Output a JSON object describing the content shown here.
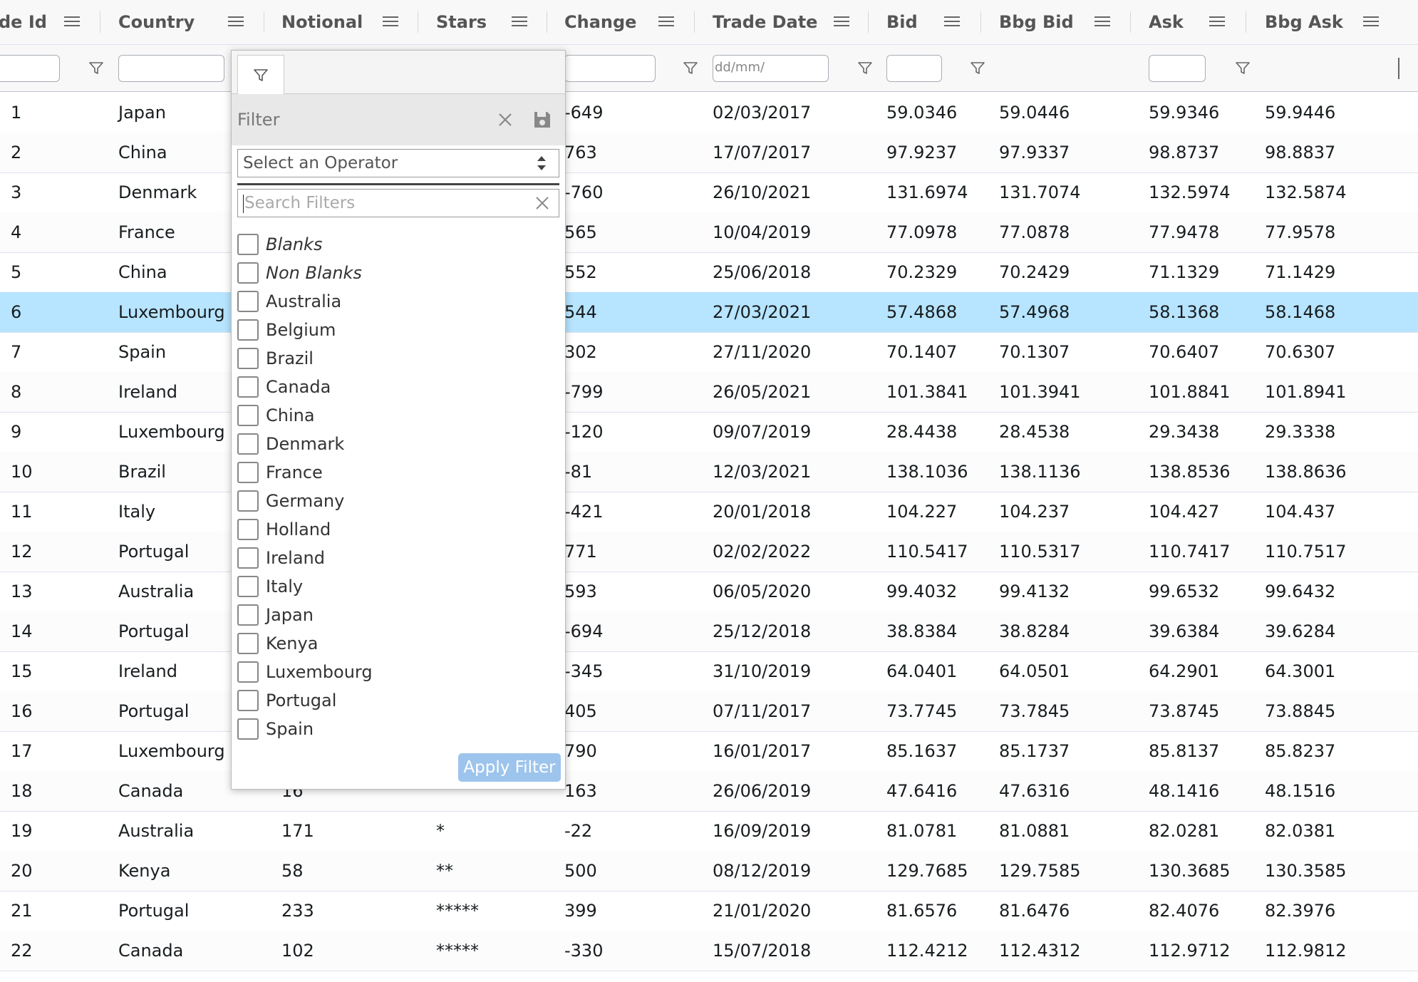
{
  "columns": [
    {
      "label": "de Id"
    },
    {
      "label": "Country"
    },
    {
      "label": "Notional"
    },
    {
      "label": "Stars"
    },
    {
      "label": "Change"
    },
    {
      "label": "Trade Date"
    },
    {
      "label": "Bid"
    },
    {
      "label": "Bbg Bid"
    },
    {
      "label": "Ask"
    },
    {
      "label": "Bbg Ask"
    }
  ],
  "filters": {
    "trade_date_placeholder": "dd/mm/"
  },
  "rows": [
    {
      "id": "1",
      "country": "Japan",
      "notional": "",
      "stars": "",
      "change": "-649",
      "date": "02/03/2017",
      "bid": "59.0346",
      "bbg_bid": "59.0446",
      "ask": "59.9346",
      "bbg_ask": "59.9446"
    },
    {
      "id": "2",
      "country": "China",
      "notional": "",
      "stars": "",
      "change": "763",
      "date": "17/07/2017",
      "bid": "97.9237",
      "bbg_bid": "97.9337",
      "ask": "98.8737",
      "bbg_ask": "98.8837"
    },
    {
      "id": "3",
      "country": "Denmark",
      "notional": "",
      "stars": "",
      "change": "-760",
      "date": "26/10/2021",
      "bid": "131.6974",
      "bbg_bid": "131.7074",
      "ask": "132.5974",
      "bbg_ask": "132.5874"
    },
    {
      "id": "4",
      "country": "France",
      "notional": "",
      "stars": "",
      "change": "565",
      "date": "10/04/2019",
      "bid": "77.0978",
      "bbg_bid": "77.0878",
      "ask": "77.9478",
      "bbg_ask": "77.9578"
    },
    {
      "id": "5",
      "country": "China",
      "notional": "",
      "stars": "",
      "change": "552",
      "date": "25/06/2018",
      "bid": "70.2329",
      "bbg_bid": "70.2429",
      "ask": "71.1329",
      "bbg_ask": "71.1429"
    },
    {
      "id": "6",
      "country": "Luxembourg",
      "notional": "",
      "stars": "",
      "change": "544",
      "date": "27/03/2021",
      "bid": "57.4868",
      "bbg_bid": "57.4968",
      "ask": "58.1368",
      "bbg_ask": "58.1468"
    },
    {
      "id": "7",
      "country": "Spain",
      "notional": "",
      "stars": "",
      "change": "302",
      "date": "27/11/2020",
      "bid": "70.1407",
      "bbg_bid": "70.1307",
      "ask": "70.6407",
      "bbg_ask": "70.6307"
    },
    {
      "id": "8",
      "country": "Ireland",
      "notional": "",
      "stars": "",
      "change": "-799",
      "date": "26/05/2021",
      "bid": "101.3841",
      "bbg_bid": "101.3941",
      "ask": "101.8841",
      "bbg_ask": "101.8941"
    },
    {
      "id": "9",
      "country": "Luxembourg",
      "notional": "",
      "stars": "",
      "change": "-120",
      "date": "09/07/2019",
      "bid": "28.4438",
      "bbg_bid": "28.4538",
      "ask": "29.3438",
      "bbg_ask": "29.3338"
    },
    {
      "id": "10",
      "country": "Brazil",
      "notional": "",
      "stars": "",
      "change": "-81",
      "date": "12/03/2021",
      "bid": "138.1036",
      "bbg_bid": "138.1136",
      "ask": "138.8536",
      "bbg_ask": "138.8636"
    },
    {
      "id": "11",
      "country": "Italy",
      "notional": "",
      "stars": "",
      "change": "-421",
      "date": "20/01/2018",
      "bid": "104.227",
      "bbg_bid": "104.237",
      "ask": "104.427",
      "bbg_ask": "104.437"
    },
    {
      "id": "12",
      "country": "Portugal",
      "notional": "",
      "stars": "",
      "change": "771",
      "date": "02/02/2022",
      "bid": "110.5417",
      "bbg_bid": "110.5317",
      "ask": "110.7417",
      "bbg_ask": "110.7517"
    },
    {
      "id": "13",
      "country": "Australia",
      "notional": "",
      "stars": "",
      "change": "593",
      "date": "06/05/2020",
      "bid": "99.4032",
      "bbg_bid": "99.4132",
      "ask": "99.6532",
      "bbg_ask": "99.6432"
    },
    {
      "id": "14",
      "country": "Portugal",
      "notional": "",
      "stars": "",
      "change": "-694",
      "date": "25/12/2018",
      "bid": "38.8384",
      "bbg_bid": "38.8284",
      "ask": "39.6384",
      "bbg_ask": "39.6284"
    },
    {
      "id": "15",
      "country": "Ireland",
      "notional": "",
      "stars": "",
      "change": "-345",
      "date": "31/10/2019",
      "bid": "64.0401",
      "bbg_bid": "64.0501",
      "ask": "64.2901",
      "bbg_ask": "64.3001"
    },
    {
      "id": "16",
      "country": "Portugal",
      "notional": "",
      "stars": "",
      "change": "405",
      "date": "07/11/2017",
      "bid": "73.7745",
      "bbg_bid": "73.7845",
      "ask": "73.8745",
      "bbg_ask": "73.8845"
    },
    {
      "id": "17",
      "country": "Luxembourg",
      "notional": "",
      "stars": "",
      "change": "790",
      "date": "16/01/2017",
      "bid": "85.1637",
      "bbg_bid": "85.1737",
      "ask": "85.8137",
      "bbg_ask": "85.8237"
    },
    {
      "id": "18",
      "country": "Canada",
      "notional": "16",
      "stars": "",
      "change": "163",
      "date": "26/06/2019",
      "bid": "47.6416",
      "bbg_bid": "47.6316",
      "ask": "48.1416",
      "bbg_ask": "48.1516"
    },
    {
      "id": "19",
      "country": "Australia",
      "notional": "171",
      "stars": "*",
      "change": "-22",
      "date": "16/09/2019",
      "bid": "81.0781",
      "bbg_bid": "81.0881",
      "ask": "82.0281",
      "bbg_ask": "82.0381"
    },
    {
      "id": "20",
      "country": "Kenya",
      "notional": "58",
      "stars": "**",
      "change": "500",
      "date": "08/12/2019",
      "bid": "129.7685",
      "bbg_bid": "129.7585",
      "ask": "130.3685",
      "bbg_ask": "130.3585"
    },
    {
      "id": "21",
      "country": "Portugal",
      "notional": "233",
      "stars": "*****",
      "change": "399",
      "date": "21/01/2020",
      "bid": "81.6576",
      "bbg_bid": "81.6476",
      "ask": "82.4076",
      "bbg_ask": "82.3976"
    },
    {
      "id": "22",
      "country": "Canada",
      "notional": "102",
      "stars": "*****",
      "change": "-330",
      "date": "15/07/2018",
      "bid": "112.4212",
      "bbg_bid": "112.4312",
      "ask": "112.9712",
      "bbg_ask": "112.9812"
    }
  ],
  "selected_row": "6",
  "popup": {
    "title": "Filter",
    "operator_placeholder": "Select an Operator",
    "search_placeholder": "Search Filters",
    "items": [
      {
        "label": "Blanks",
        "italic": true
      },
      {
        "label": "Non Blanks",
        "italic": true
      },
      {
        "label": "Australia"
      },
      {
        "label": "Belgium"
      },
      {
        "label": "Brazil"
      },
      {
        "label": "Canada"
      },
      {
        "label": "China"
      },
      {
        "label": "Denmark"
      },
      {
        "label": "France"
      },
      {
        "label": "Germany"
      },
      {
        "label": "Holland"
      },
      {
        "label": "Ireland"
      },
      {
        "label": "Italy"
      },
      {
        "label": "Japan"
      },
      {
        "label": "Kenya"
      },
      {
        "label": "Luxembourg"
      },
      {
        "label": "Portugal"
      },
      {
        "label": "Spain"
      }
    ],
    "apply_label": "Apply Filter"
  },
  "colors": {
    "selected_row": "#b7e4ff",
    "apply_button": "#9dc4ec"
  }
}
